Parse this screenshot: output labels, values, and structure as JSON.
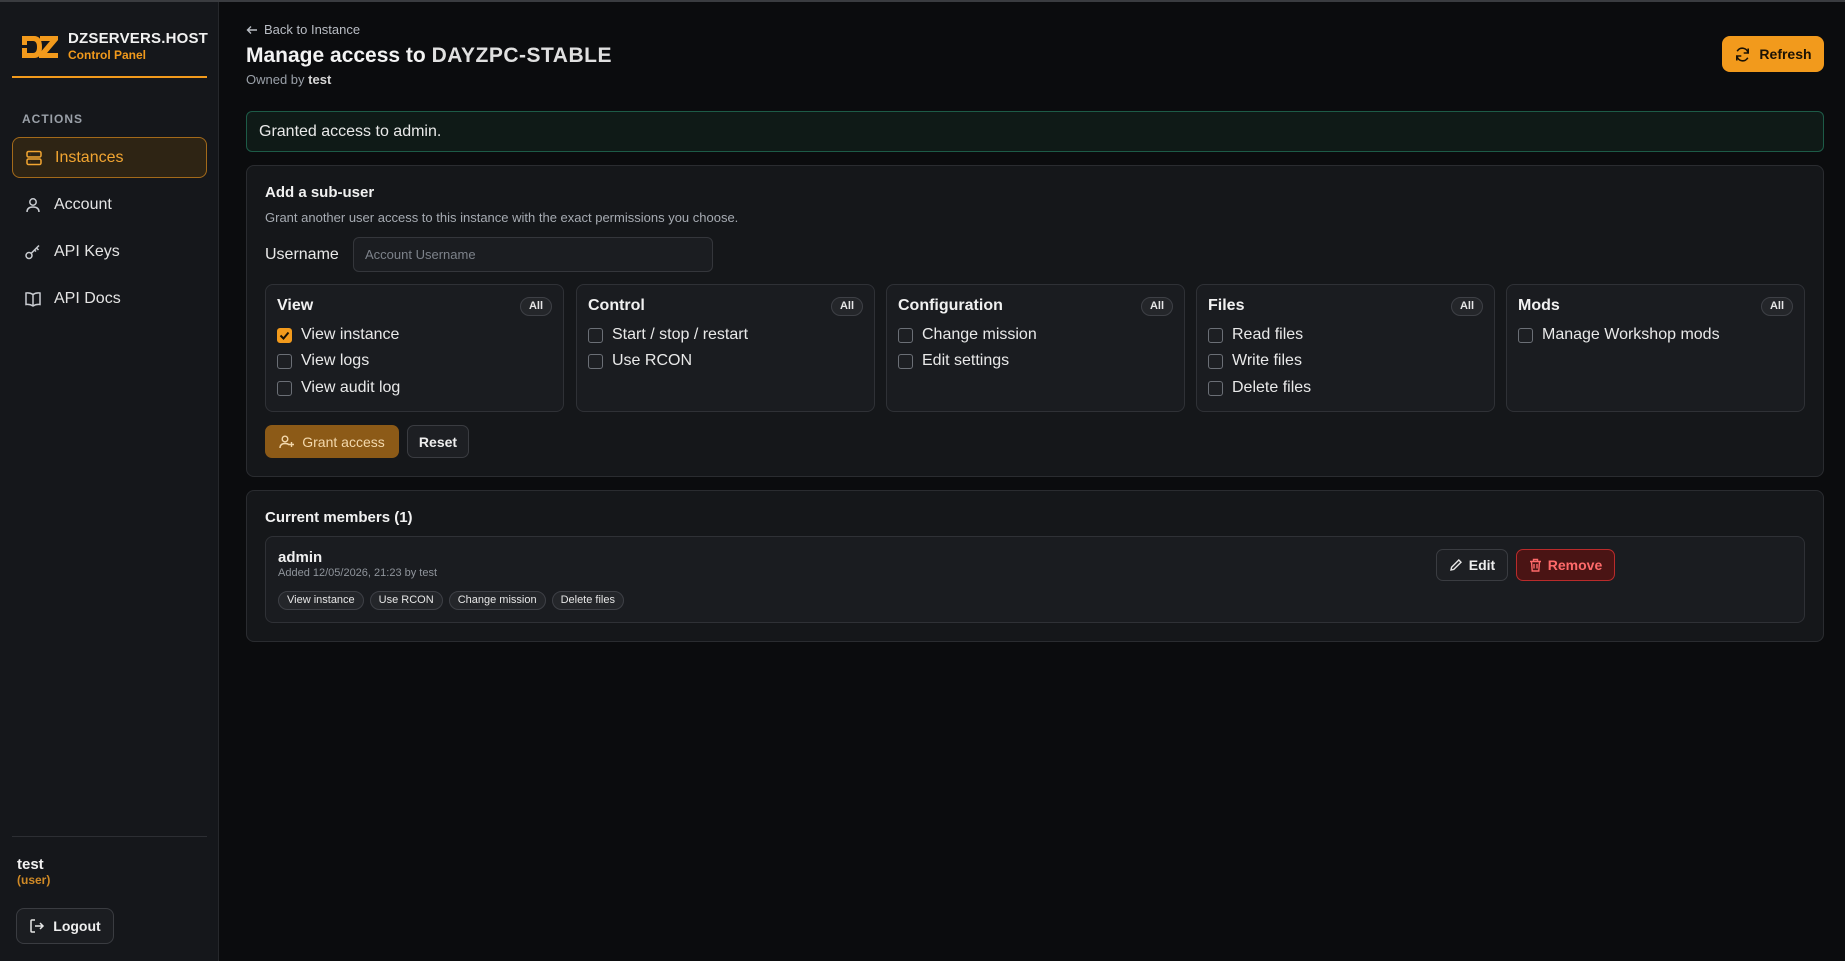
{
  "brand": {
    "name": "DZSERVERS.HOST",
    "sub": "Control Panel",
    "logo_text": "DZ"
  },
  "sidebar": {
    "section_label": "ACTIONS",
    "items": [
      {
        "label": "Instances",
        "icon": "server-icon",
        "active": true
      },
      {
        "label": "Account",
        "icon": "user-icon",
        "active": false
      },
      {
        "label": "API Keys",
        "icon": "key-icon",
        "active": false
      },
      {
        "label": "API Docs",
        "icon": "book-icon",
        "active": false
      }
    ],
    "user": {
      "name": "test",
      "role": "(user)"
    },
    "logout_label": "Logout"
  },
  "header": {
    "back_label": "Back to Instance",
    "title_prefix": "Manage access to",
    "instance_name": "DAYZPC-STABLE",
    "owned_by_label": "Owned by",
    "owner": "test",
    "refresh_label": "Refresh"
  },
  "alert": {
    "message": "Granted access to admin."
  },
  "add_subuser": {
    "title": "Add a sub-user",
    "description": "Grant another user access to this instance with the exact permissions you choose.",
    "username_label": "Username",
    "username_placeholder": "Account Username",
    "username_value": "",
    "all_label": "All",
    "groups": [
      {
        "title": "View",
        "perms": [
          {
            "label": "View instance",
            "checked": true
          },
          {
            "label": "View logs",
            "checked": false
          },
          {
            "label": "View audit log",
            "checked": false
          }
        ]
      },
      {
        "title": "Control",
        "perms": [
          {
            "label": "Start / stop / restart",
            "checked": false
          },
          {
            "label": "Use RCON",
            "checked": false
          }
        ]
      },
      {
        "title": "Configuration",
        "perms": [
          {
            "label": "Change mission",
            "checked": false
          },
          {
            "label": "Edit settings",
            "checked": false
          }
        ]
      },
      {
        "title": "Files",
        "perms": [
          {
            "label": "Read files",
            "checked": false
          },
          {
            "label": "Write files",
            "checked": false
          },
          {
            "label": "Delete files",
            "checked": false
          }
        ]
      },
      {
        "title": "Mods",
        "perms": [
          {
            "label": "Manage Workshop mods",
            "checked": false
          }
        ]
      }
    ],
    "grant_label": "Grant access",
    "reset_label": "Reset"
  },
  "members": {
    "title": "Current members (1)",
    "list": [
      {
        "name": "admin",
        "added": "Added 12/05/2026, 21:23 by test",
        "tags": [
          "View instance",
          "Use RCON",
          "Change mission",
          "Delete files"
        ],
        "edit_label": "Edit",
        "remove_label": "Remove"
      }
    ]
  },
  "colors": {
    "accent": "#f29a1c",
    "danger": "#ff6a6a",
    "success_border": "#1d5b47"
  }
}
